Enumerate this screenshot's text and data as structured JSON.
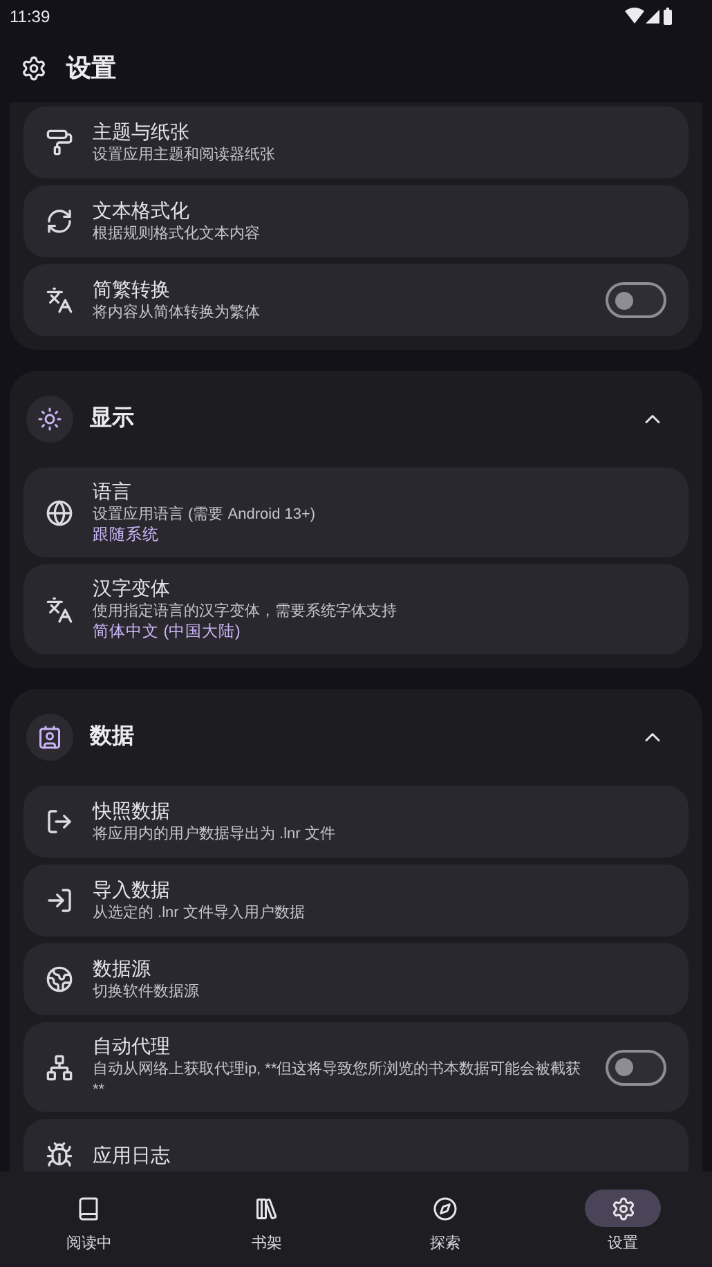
{
  "status_bar": {
    "time": "11:39"
  },
  "header": {
    "title": "设置"
  },
  "sections": [
    {
      "items": [
        {
          "kind": "nav",
          "title": "主题与纸张",
          "subtitle": "设置应用主题和阅读器纸张"
        },
        {
          "kind": "nav",
          "title": "文本格式化",
          "subtitle": "根据规则格式化文本内容"
        },
        {
          "kind": "switch",
          "title": "简繁转换",
          "subtitle": "将内容从简体转换为繁体",
          "on": false
        }
      ]
    },
    {
      "title": "显示",
      "expanded": true,
      "items": [
        {
          "kind": "nav",
          "title": "语言",
          "subtitle": "设置应用语言 (需要 Android 13+)",
          "value": "跟随系统"
        },
        {
          "kind": "nav",
          "title": "汉字变体",
          "subtitle": "使用指定语言的汉字变体，需要系统字体支持",
          "value": "简体中文 (中国大陆)"
        }
      ]
    },
    {
      "title": "数据",
      "expanded": true,
      "items": [
        {
          "kind": "nav",
          "title": "快照数据",
          "subtitle": "将应用内的用户数据导出为 .lnr 文件"
        },
        {
          "kind": "nav",
          "title": "导入数据",
          "subtitle": "从选定的 .lnr 文件导入用户数据"
        },
        {
          "kind": "nav",
          "title": "数据源",
          "subtitle": "切换软件数据源"
        },
        {
          "kind": "switch",
          "title": "自动代理",
          "subtitle": "自动从网络上获取代理ip, **但这将导致您所浏览的书本数据可能会被截获**",
          "on": false
        },
        {
          "kind": "nav",
          "title": "应用日志"
        }
      ]
    }
  ],
  "bottom_nav": [
    {
      "label": "阅读中",
      "selected": false
    },
    {
      "label": "书架",
      "selected": false
    },
    {
      "label": "探索",
      "selected": false
    },
    {
      "label": "设置",
      "selected": true
    }
  ]
}
